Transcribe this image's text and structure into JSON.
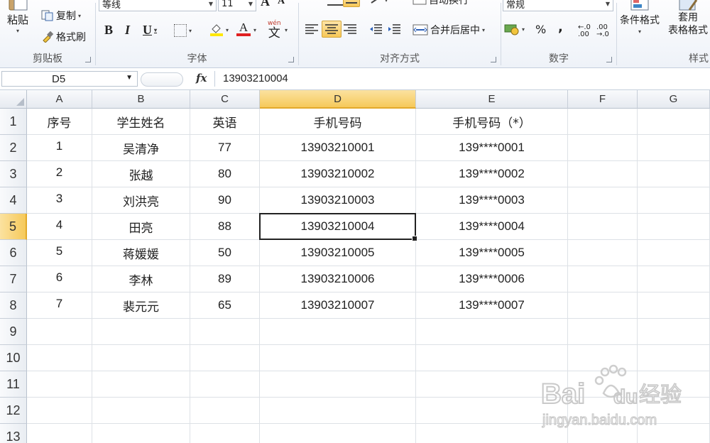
{
  "ribbon": {
    "clipboard": {
      "group_label": "剪贴板",
      "paste_label": "粘贴",
      "copy_label": "复制",
      "format_painter_label": "格式刷"
    },
    "font": {
      "group_label": "字体",
      "font_name": "等线",
      "font_size": "11",
      "bold_label": "B",
      "italic_label": "I",
      "underline_label": "U",
      "font_color_letter": "A",
      "wen_label": "wén",
      "wen_char": "文",
      "grow_label": "A",
      "shrink_label": "A"
    },
    "alignment": {
      "group_label": "对齐方式",
      "wrap_text_label": "自动换行",
      "merge_center_label": "合并后居中"
    },
    "number": {
      "group_label": "数字",
      "format_value": "常规",
      "percent_label": "%",
      "comma_label": ",",
      "inc_decimal_label": "←.0 .00",
      "dec_decimal_label": ".00 →.0"
    },
    "styles": {
      "group_label": "样式",
      "conditional_format_label": "条件格式",
      "table_format_line1": "套用",
      "table_format_line2": "表格格式"
    }
  },
  "formula_bar": {
    "name_box": "D5",
    "fx_label": "fx",
    "content": "13903210004"
  },
  "grid": {
    "columns": [
      "A",
      "B",
      "C",
      "D",
      "E",
      "F",
      "G"
    ],
    "selected_column": "D",
    "rows": [
      "1",
      "2",
      "3",
      "4",
      "5",
      "6",
      "7",
      "8",
      "9",
      "10",
      "11",
      "12",
      "13"
    ],
    "selected_row": "5",
    "header": [
      "序号",
      "学生姓名",
      "英语",
      "手机号码",
      "手机号码（*）"
    ],
    "data": [
      [
        "1",
        "吴清净",
        "77",
        "13903210001",
        "139****0001"
      ],
      [
        "2",
        "张越",
        "80",
        "13903210002",
        "139****0002"
      ],
      [
        "3",
        "刘洪亮",
        "90",
        "13903210003",
        "139****0003"
      ],
      [
        "4",
        "田亮",
        "88",
        "13903210004",
        "139****0004"
      ],
      [
        "5",
        "蒋媛媛",
        "50",
        "13903210005",
        "139****0005"
      ],
      [
        "6",
        "李林",
        "89",
        "13903210006",
        "139****0006"
      ],
      [
        "7",
        "裴元元",
        "65",
        "13903210007",
        "139****0007"
      ]
    ]
  },
  "watermark": {
    "brand_text": "Bai",
    "brand_text2": "du",
    "suffix": "经验",
    "url": "jingyan.baidu.com"
  },
  "colors": {
    "selection_header": "#f6c95a",
    "font_color_bar": "#e02020",
    "highlight_bar": "#ffe800"
  }
}
